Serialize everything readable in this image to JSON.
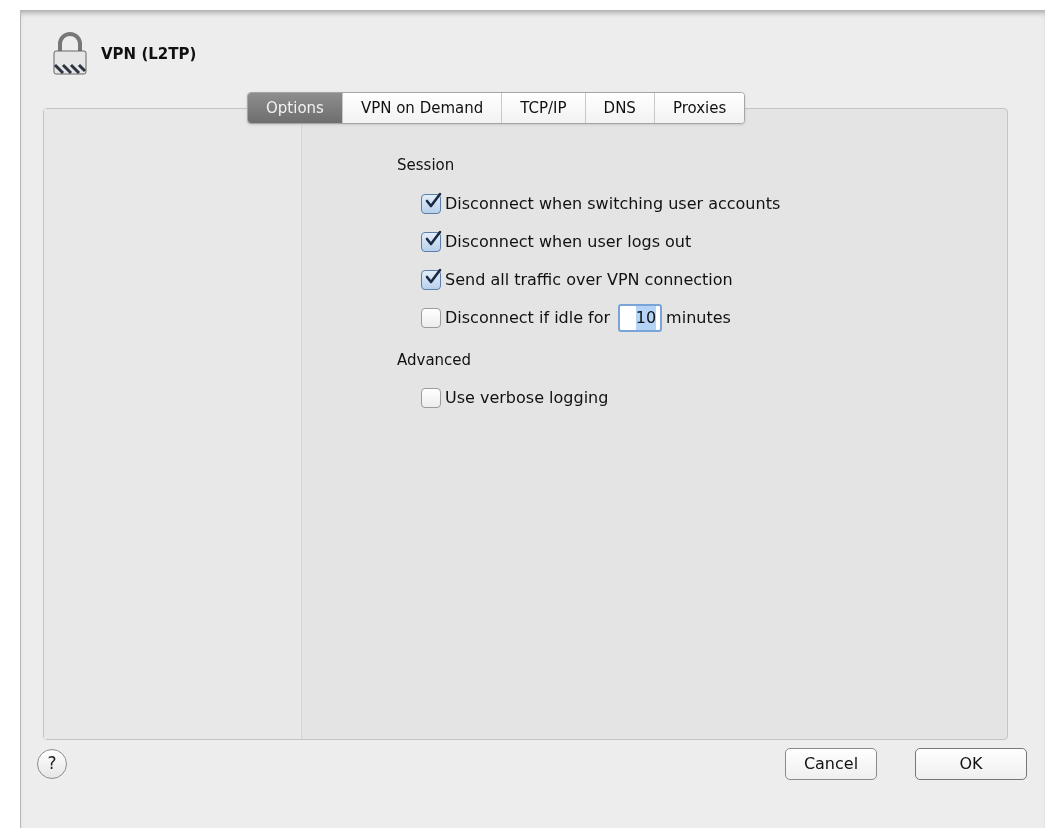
{
  "sheet": {
    "title": "VPN (L2TP)",
    "tabs": [
      {
        "label": "Options",
        "selected": true
      },
      {
        "label": "VPN on Demand",
        "selected": false
      },
      {
        "label": "TCP/IP",
        "selected": false
      },
      {
        "label": "DNS",
        "selected": false
      },
      {
        "label": "Proxies",
        "selected": false
      }
    ],
    "sections": [
      {
        "heading": "Session",
        "options": [
          {
            "kind": "checkbox",
            "label": "Disconnect when switching user accounts",
            "checked": true
          },
          {
            "kind": "checkbox",
            "label": "Disconnect when user logs out",
            "checked": true
          },
          {
            "kind": "checkbox",
            "label": "Send all traffic over VPN connection",
            "checked": true
          },
          {
            "kind": "idle",
            "label": "Disconnect if idle for",
            "value": "10",
            "suffix": "minutes",
            "checked": false
          }
        ]
      },
      {
        "heading": "Advanced",
        "options": [
          {
            "kind": "checkbox",
            "label": "Use verbose logging",
            "checked": false
          }
        ]
      }
    ],
    "help": "?",
    "buttons": [
      {
        "label": "Cancel",
        "kind": "secondary"
      },
      {
        "label": "OK",
        "kind": "default"
      }
    ]
  }
}
